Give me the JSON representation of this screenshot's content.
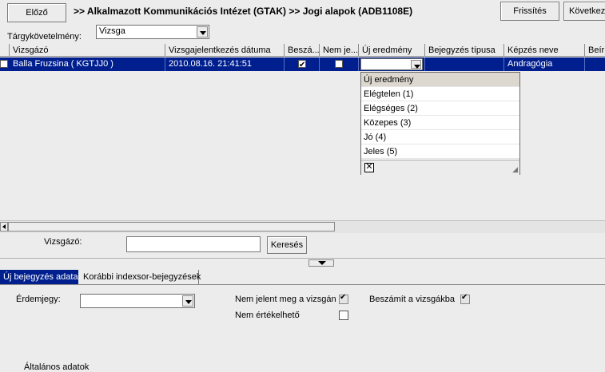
{
  "toolbar": {
    "back_label": "Előző",
    "refresh_label": "Frissítés",
    "next_label": "Következő"
  },
  "breadcrumb": ">> Alkalmazott Kommunikációs Intézet (GTAK) >> Jogi alapok (ADB1108E)",
  "filter": {
    "label": "Tárgykövetelmény:",
    "value": "Vizsga"
  },
  "table": {
    "columns": [
      "Vizsgázó",
      "Vizsgajelentkezés dátuma",
      "Beszá...",
      "Nem je...",
      "Új eredmény",
      "Bejegyzés típusa",
      "Képzés neve",
      "Beír"
    ],
    "rows": [
      {
        "student": "Balla Fruzsina ( KGTJJ0 )",
        "date": "2010.08.16. 21:41:51",
        "counted": true,
        "absent": false,
        "result": "",
        "entry_type": "",
        "training": "Andragógia"
      }
    ]
  },
  "result_dropdown": {
    "header": "Új eredmény",
    "options": [
      "Elégtelen (1)",
      "Elégséges (2)",
      "Közepes (3)",
      "Jó (4)",
      "Jeles (5)"
    ]
  },
  "search": {
    "label": "Vizsgázó:",
    "value": "",
    "button_label": "Keresés"
  },
  "tabs": [
    {
      "label": "Új bejegyzés adatai",
      "active": true
    },
    {
      "label": "Korábbi indexsor-bejegyzések",
      "active": false
    }
  ],
  "form": {
    "grade_label": "Érdemjegy:",
    "grade_value": "",
    "absent_label": "Nem jelent meg a vizsgán",
    "absent_checked": true,
    "counted_label": "Beszámít a vizsgákba",
    "counted_checked": true,
    "not_evaluable_label": "Nem értékelhető",
    "not_evaluable_checked": false,
    "bottom_label": "Általános adatok"
  }
}
